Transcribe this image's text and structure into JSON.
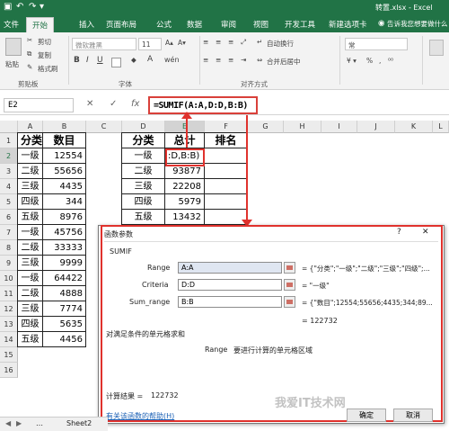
{
  "window": {
    "title": "转置.xlsx - Excel"
  },
  "tabs": [
    "文件",
    "开始",
    "插入",
    "页面布局",
    "公式",
    "数据",
    "审阅",
    "视图",
    "开发工具",
    "新建选项卡"
  ],
  "active_tab": "开始",
  "tell_me": "告诉我您想要做什么",
  "ribbon": {
    "clipboard": {
      "cut": "剪切",
      "copy": "复制",
      "paste": "粘贴",
      "format_painter": "格式刷",
      "group": "剪贴板"
    },
    "font": {
      "family": "微软雅黑",
      "size": "11",
      "group": "字体"
    },
    "alignment": {
      "wrap": "自动换行",
      "merge": "合并后居中",
      "group": "对齐方式"
    },
    "number": {
      "group": "常"
    }
  },
  "formula_bar": {
    "name_box": "E2",
    "cancel": "✕",
    "enter": "✓",
    "fx": "fx",
    "formula": "=SUMIF(A:A,D:D,B:B)"
  },
  "columns": [
    "A",
    "B",
    "C",
    "D",
    "E",
    "F",
    "G",
    "H",
    "I",
    "J",
    "K",
    "L"
  ],
  "rows": [
    "1",
    "2",
    "3",
    "4",
    "5",
    "6",
    "7",
    "8",
    "9",
    "10",
    "11",
    "12",
    "13",
    "14",
    "15",
    "16"
  ],
  "left_table": {
    "headers": [
      "分类",
      "数目"
    ],
    "data": [
      [
        "一级",
        "12554"
      ],
      [
        "二级",
        "55656"
      ],
      [
        "三级",
        "4435"
      ],
      [
        "四级",
        "344"
      ],
      [
        "五级",
        "8976"
      ],
      [
        "一级",
        "45756"
      ],
      [
        "二级",
        "33333"
      ],
      [
        "三级",
        "9999"
      ],
      [
        "一级",
        "64422"
      ],
      [
        "二级",
        "4888"
      ],
      [
        "三级",
        "7774"
      ],
      [
        "四级",
        "5635"
      ],
      [
        "五级",
        "4456"
      ]
    ]
  },
  "right_table": {
    "headers": [
      "分类",
      "总计",
      "排名"
    ],
    "data": [
      [
        "一级",
        ":D,B:B)",
        ""
      ],
      [
        "二级",
        "93877",
        ""
      ],
      [
        "三级",
        "22208",
        ""
      ],
      [
        "四级",
        "5979",
        ""
      ],
      [
        "五级",
        "13432",
        ""
      ]
    ]
  },
  "dialog": {
    "title": "函数参数",
    "function_name": "SUMIF",
    "args": [
      {
        "label": "Range",
        "value": "A:A",
        "result": "= {\"分类\";\"一级\";\"二级\";\"三级\";\"四级\";..."
      },
      {
        "label": "Criteria",
        "value": "D:D",
        "result": "= \"一级\""
      },
      {
        "label": "Sum_range",
        "value": "B:B",
        "result": "= {\"数目\";12554;55656;4435;344;89..."
      }
    ],
    "total": "= 122732",
    "description": "对满足条件的单元格求和",
    "arg_desc_label": "Range",
    "arg_desc": "要进行计算的单元格区域",
    "result_label": "计算结果 =",
    "result_value": "122732",
    "help_link": "有关该函数的帮助(H)",
    "ok": "确定",
    "cancel": "取消"
  },
  "sheet_tab": "Sheet2",
  "watermark": "我爱IT技术网"
}
